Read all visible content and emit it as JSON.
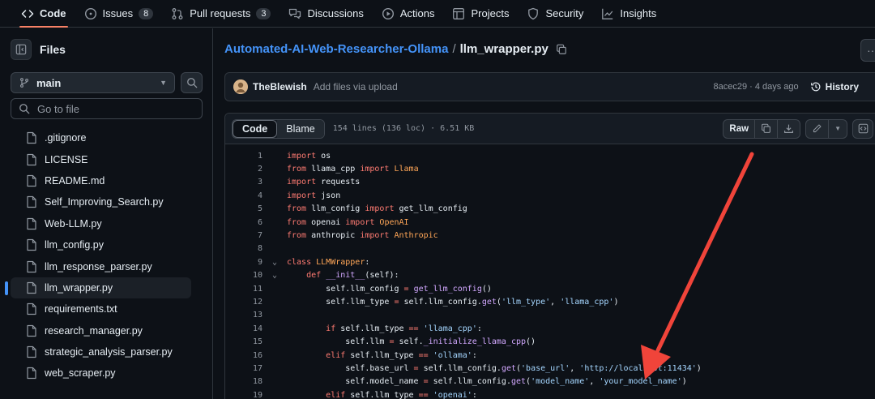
{
  "topnav": {
    "tabs": [
      {
        "label": "Code",
        "icon": "code-icon",
        "active": true
      },
      {
        "label": "Issues",
        "icon": "issue-opened-icon",
        "count": "8"
      },
      {
        "label": "Pull requests",
        "icon": "git-pull-request-icon",
        "count": "3"
      },
      {
        "label": "Discussions",
        "icon": "comment-discussion-icon"
      },
      {
        "label": "Actions",
        "icon": "play-icon"
      },
      {
        "label": "Projects",
        "icon": "table-icon"
      },
      {
        "label": "Security",
        "icon": "shield-icon"
      },
      {
        "label": "Insights",
        "icon": "graph-icon"
      }
    ]
  },
  "sidebar": {
    "title": "Files",
    "branch": "main",
    "goto_placeholder": "Go to file",
    "files": [
      {
        "name": ".gitignore"
      },
      {
        "name": "LICENSE"
      },
      {
        "name": "README.md"
      },
      {
        "name": "Self_Improving_Search.py"
      },
      {
        "name": "Web-LLM.py"
      },
      {
        "name": "llm_config.py"
      },
      {
        "name": "llm_response_parser.py"
      },
      {
        "name": "llm_wrapper.py",
        "selected": true
      },
      {
        "name": "requirements.txt"
      },
      {
        "name": "research_manager.py"
      },
      {
        "name": "strategic_analysis_parser.py"
      },
      {
        "name": "web_scraper.py"
      }
    ]
  },
  "breadcrumb": {
    "repo": "Automated-AI-Web-Researcher-Ollama",
    "separator": "/",
    "file": "llm_wrapper.py"
  },
  "commit": {
    "author": "TheBlewish",
    "message": "Add files via upload",
    "meta": "8acec29 · 4 days ago",
    "history_label": "History"
  },
  "codeview": {
    "code_tab": "Code",
    "blame_tab": "Blame",
    "info": "154 lines (136 loc) · 6.51 KB",
    "raw_label": "Raw"
  },
  "colors": {
    "accent_link": "#4493f8",
    "active_tab_underline": "#f78166",
    "annotation_arrow": "#f0443a"
  }
}
